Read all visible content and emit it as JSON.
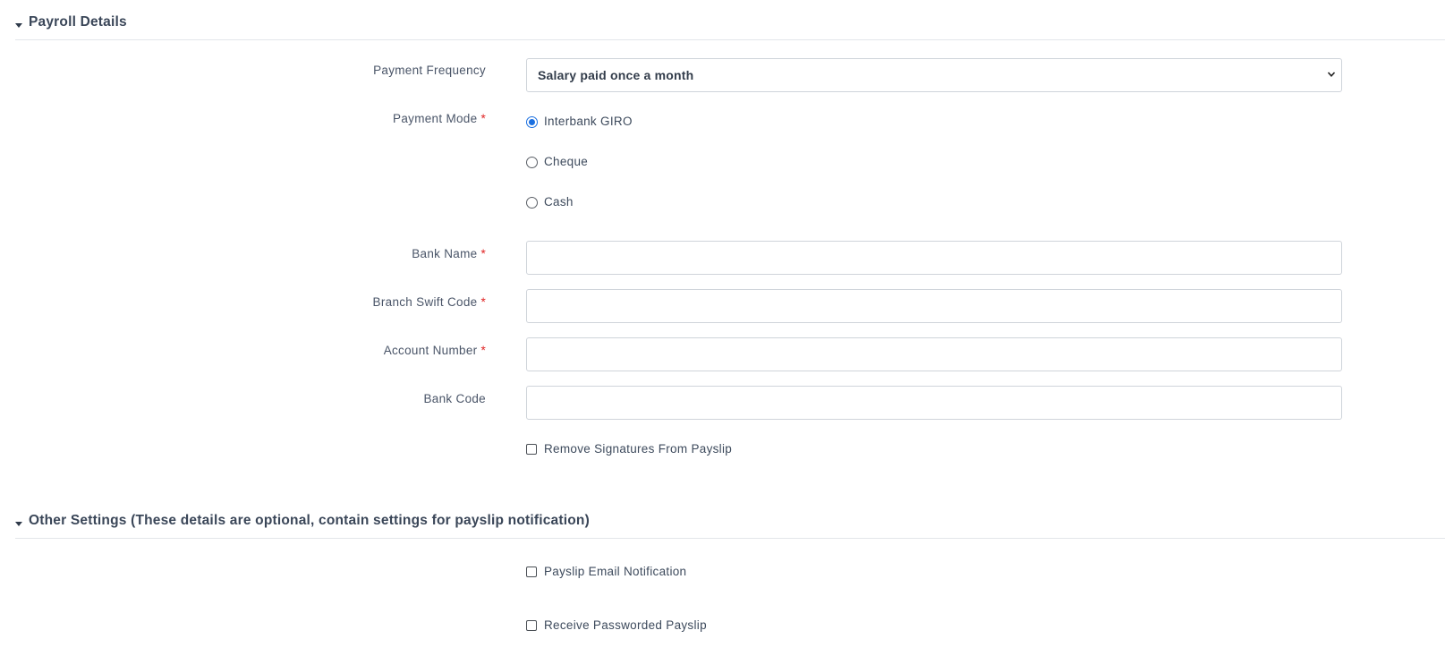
{
  "payroll": {
    "title": "Payroll Details",
    "payment_frequency": {
      "label": "Payment Frequency",
      "selected": "Salary paid once a month"
    },
    "payment_mode": {
      "label": "Payment Mode",
      "required": "*",
      "options": [
        "Interbank GIRO",
        "Cheque",
        "Cash"
      ],
      "selected": "Interbank GIRO"
    },
    "bank_name": {
      "label": "Bank Name",
      "required": "*",
      "value": ""
    },
    "branch_swift_code": {
      "label": "Branch Swift Code",
      "required": "*",
      "value": ""
    },
    "account_number": {
      "label": "Account Number",
      "required": "*",
      "value": ""
    },
    "bank_code": {
      "label": "Bank Code",
      "value": ""
    },
    "remove_signatures": {
      "label": "Remove Signatures From Payslip",
      "checked": false
    }
  },
  "other_settings": {
    "title": "Other Settings (These details are optional, contain settings for payslip notification)",
    "payslip_email": {
      "label": "Payslip Email Notification",
      "checked": false
    },
    "passworded_payslip": {
      "label": "Receive Passworded Payslip",
      "checked": false
    }
  },
  "colors": {
    "accent": "#1a6fe0",
    "required": "#e02424",
    "border": "#cfd4da",
    "text": "#3d4a5c"
  },
  "icons": {
    "section_toggle": "caret-down-icon",
    "select_arrow": "chevron-down-icon"
  }
}
